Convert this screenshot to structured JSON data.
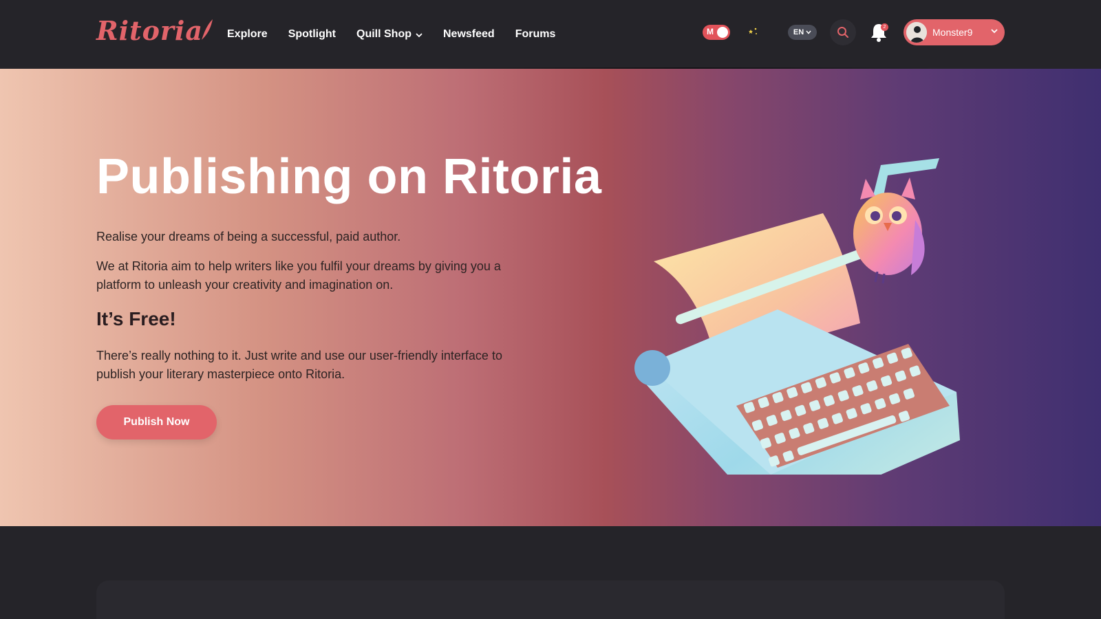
{
  "brand": {
    "logo_text": "Ritoria",
    "accent_color": "#e2646a"
  },
  "nav": {
    "items": [
      {
        "label": "Explore"
      },
      {
        "label": "Spotlight"
      },
      {
        "label": "Quill Shop",
        "has_dropdown": true
      },
      {
        "label": "Newsfeed"
      },
      {
        "label": "Forums"
      }
    ]
  },
  "header": {
    "mode_toggle_letter": "M",
    "language": "EN",
    "notification_count": "2",
    "username": "Monster9",
    "icons": [
      "sun-stars-icon",
      "moon-icon",
      "search-icon",
      "bell-icon",
      "chevron-down-icon"
    ]
  },
  "hero": {
    "title": "Publishing on Ritoria",
    "paragraph_1": "Realise your dreams of being a successful, paid author.",
    "paragraph_2": "We at Ritoria aim to help writers like you fulfil your dreams by giving you a platform to unleash your creativity and imagination on.",
    "subheading": "It’s Free!",
    "paragraph_3": "There’s really nothing to it. Just write and use our user-friendly interface to publish your literary masterpiece onto Ritoria.",
    "cta_label": "Publish Now"
  }
}
